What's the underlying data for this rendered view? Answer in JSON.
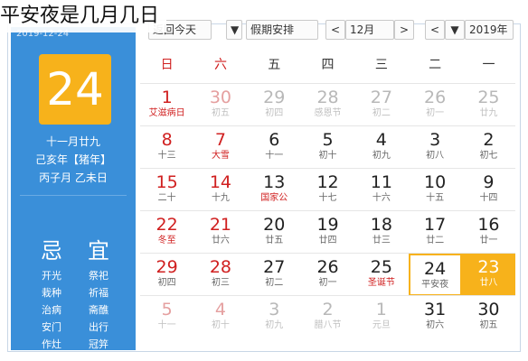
{
  "caption": "平安夜是几月几日",
  "side": {
    "top_text": "2019-12-24",
    "big_day": "24",
    "lunar_lines": [
      "十一月廿九",
      "己亥年【猪年】",
      "丙子月 乙未日"
    ],
    "yi_label": "宜",
    "ji_label": "忌",
    "yi_items": [
      "祭祀",
      "祈福",
      "斋醮",
      "出行",
      "冠笄"
    ],
    "ji_items": [
      "开光",
      "栽种",
      "治病",
      "安门",
      "作灶"
    ]
  },
  "toolbar": {
    "today_btn": "返回今天",
    "holiday_select": "假期安排",
    "holiday_arrow": "▼",
    "prev": "<",
    "next": ">",
    "month_select": "12月",
    "year_prev": "<",
    "year_select": "2019年",
    "year_extra": "▼"
  },
  "weekdays": [
    "一",
    "二",
    "三",
    "四",
    "五",
    "六",
    "日"
  ],
  "weeks": [
    [
      {
        "d": "25",
        "l": "廿九",
        "dim": true
      },
      {
        "d": "26",
        "l": "初一",
        "dim": true
      },
      {
        "d": "27",
        "l": "初二",
        "dim": true
      },
      {
        "d": "28",
        "l": "感恩节",
        "dim": true
      },
      {
        "d": "29",
        "l": "初四",
        "dim": true
      },
      {
        "d": "30",
        "l": "初五",
        "dim": true
      },
      {
        "d": "1",
        "l": "艾滋病日",
        "fest": true
      }
    ],
    [
      {
        "d": "2",
        "l": "初七"
      },
      {
        "d": "3",
        "l": "初八"
      },
      {
        "d": "4",
        "l": "初九"
      },
      {
        "d": "5",
        "l": "初十"
      },
      {
        "d": "6",
        "l": "十一"
      },
      {
        "d": "7",
        "l": "大雪",
        "fest": true
      },
      {
        "d": "8",
        "l": "十三"
      }
    ],
    [
      {
        "d": "9",
        "l": "十四"
      },
      {
        "d": "10",
        "l": "十五"
      },
      {
        "d": "11",
        "l": "十六"
      },
      {
        "d": "12",
        "l": "十七"
      },
      {
        "d": "13",
        "l": "国家公",
        "fest": true
      },
      {
        "d": "14",
        "l": "十九"
      },
      {
        "d": "15",
        "l": "二十"
      }
    ],
    [
      {
        "d": "16",
        "l": "廿一"
      },
      {
        "d": "17",
        "l": "廿二"
      },
      {
        "d": "18",
        "l": "廿三"
      },
      {
        "d": "19",
        "l": "廿四"
      },
      {
        "d": "20",
        "l": "廿五"
      },
      {
        "d": "21",
        "l": "廿六"
      },
      {
        "d": "22",
        "l": "冬至",
        "fest": true
      }
    ],
    [
      {
        "d": "23",
        "l": "廿八",
        "selected": true
      },
      {
        "d": "24",
        "l": "平安夜",
        "today": true
      },
      {
        "d": "25",
        "l": "圣诞节",
        "fest": true
      },
      {
        "d": "26",
        "l": "初一"
      },
      {
        "d": "27",
        "l": "初二"
      },
      {
        "d": "28",
        "l": "初三"
      },
      {
        "d": "29",
        "l": "初四"
      }
    ],
    [
      {
        "d": "30",
        "l": "初五"
      },
      {
        "d": "31",
        "l": "初六"
      },
      {
        "d": "1",
        "l": "元旦",
        "dim": true
      },
      {
        "d": "2",
        "l": "腊八节",
        "dim": true
      },
      {
        "d": "3",
        "l": "初九",
        "dim": true
      },
      {
        "d": "4",
        "l": "初十",
        "dim": true
      },
      {
        "d": "5",
        "l": "十一",
        "dim": true
      }
    ]
  ]
}
